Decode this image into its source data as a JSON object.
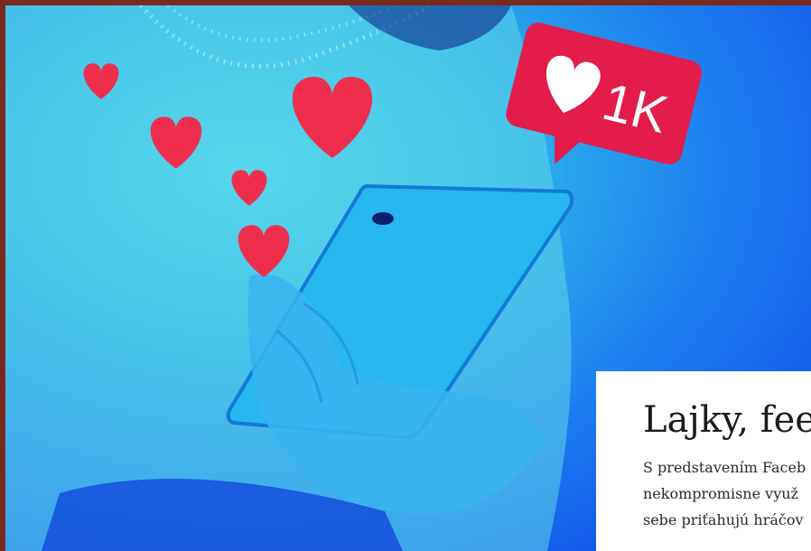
{
  "hero": {
    "like_badge": {
      "count": "1K",
      "icon": "heart-icon",
      "color": "#e31c4b"
    },
    "colors": {
      "heart": "#ef2e4d",
      "tint_light": "#4fd7ee",
      "tint_dark": "#0b3fe6"
    }
  },
  "article": {
    "title": "Lajky, fee",
    "excerpt_lines": [
      "S predstavením Faceb",
      "nekompromisne využ",
      "sebe priťahujú hráčov"
    ]
  }
}
